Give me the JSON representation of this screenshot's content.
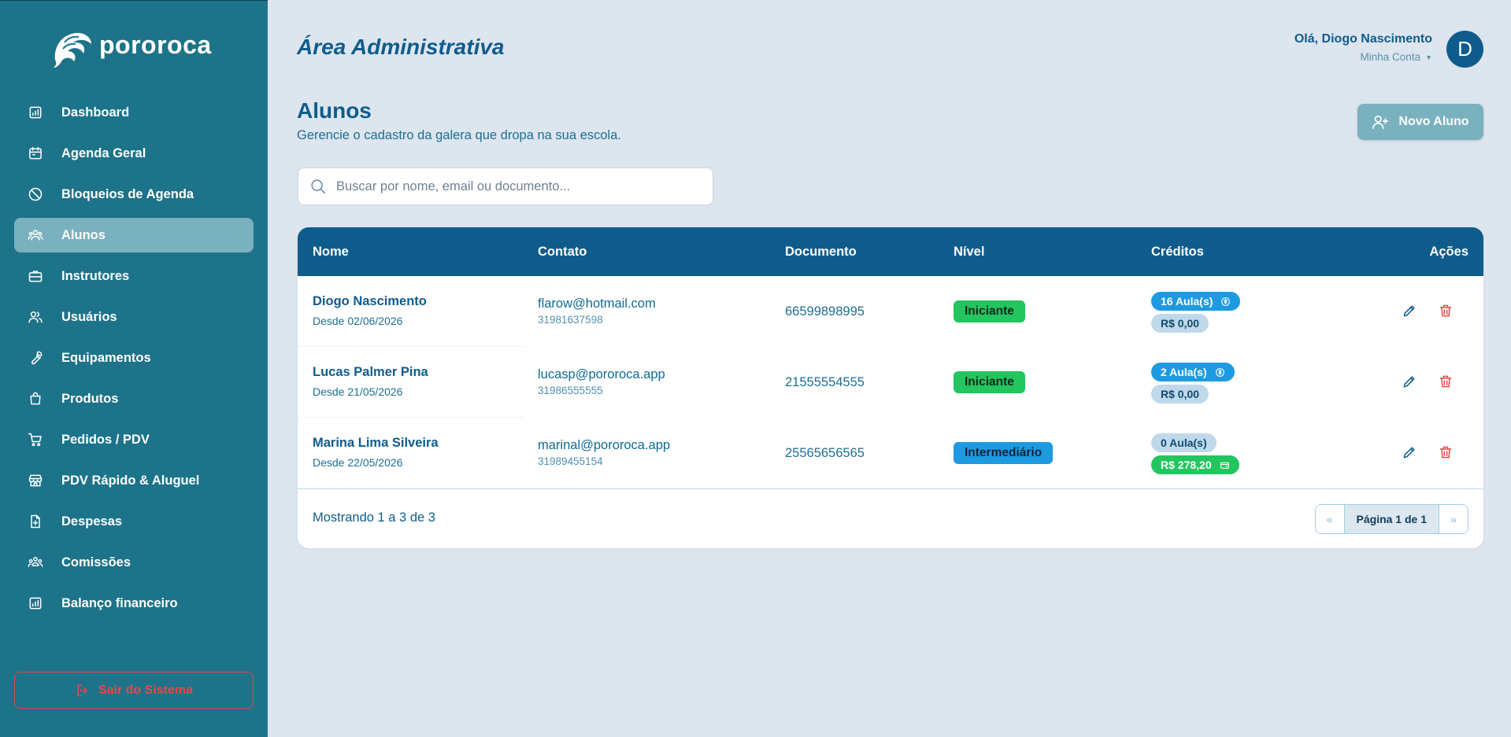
{
  "brand": {
    "name": "pororoca"
  },
  "header": {
    "title": "Área Administrativa",
    "greeting": "Olá, Diogo Nascimento",
    "account_label": "Minha Conta",
    "avatar_initial": "D"
  },
  "sidebar": {
    "items": [
      {
        "label": "Dashboard",
        "icon": "bar-chart-icon",
        "active": false
      },
      {
        "label": "Agenda Geral",
        "icon": "calendar-icon",
        "active": false
      },
      {
        "label": "Bloqueios de Agenda",
        "icon": "ban-icon",
        "active": false
      },
      {
        "label": "Alunos",
        "icon": "users-icon",
        "active": true
      },
      {
        "label": "Instrutores",
        "icon": "briefcase-icon",
        "active": false
      },
      {
        "label": "Usuários",
        "icon": "user-group-icon",
        "active": false
      },
      {
        "label": "Equipamentos",
        "icon": "wrench-icon",
        "active": false
      },
      {
        "label": "Produtos",
        "icon": "shopping-bag-icon",
        "active": false
      },
      {
        "label": "Pedidos / PDV",
        "icon": "cart-icon",
        "active": false
      },
      {
        "label": "PDV Rápido & Aluguel",
        "icon": "store-icon",
        "active": false
      },
      {
        "label": "Despesas",
        "icon": "file-plus-icon",
        "active": false
      },
      {
        "label": "Comissões",
        "icon": "team-icon",
        "active": false
      },
      {
        "label": "Balanço financeiro",
        "icon": "bar-chart-icon",
        "active": false
      }
    ],
    "logout_label": "Sair do Sistema"
  },
  "page": {
    "title": "Alunos",
    "subtitle": "Gerencie o cadastro da galera que dropa na sua escola.",
    "new_button": "Novo Aluno"
  },
  "search": {
    "placeholder": "Buscar por nome, email ou documento...",
    "value": ""
  },
  "table": {
    "headers": {
      "name": "Nome",
      "contact": "Contato",
      "document": "Documento",
      "level": "Nível",
      "credits": "Créditos",
      "actions": "Ações"
    },
    "rows": [
      {
        "name": "Diogo Nascimento",
        "since": "Desde 02/06/2026",
        "email": "flarow@hotmail.com",
        "phone": "31981637598",
        "document": "66599898995",
        "level": "Iniciante",
        "lessons": "16 Aula(s)",
        "balance": "R$ 0,00"
      },
      {
        "name": "Lucas Palmer Pina",
        "since": "Desde 21/05/2026",
        "email": "lucasp@pororoca.app",
        "phone": "31986555555",
        "document": "21555554555",
        "level": "Iniciante",
        "lessons": "2 Aula(s)",
        "balance": "R$ 0,00"
      },
      {
        "name": "Marina Lima Silveira",
        "since": "Desde 22/05/2026",
        "email": "marinal@pororoca.app",
        "phone": "31989455154",
        "document": "25565656565",
        "level": "Intermediário",
        "lessons": "0 Aula(s)",
        "balance": "R$ 278,20"
      }
    ],
    "footer": {
      "showing": "Mostrando 1 a 3 de 3",
      "page": "Página 1 de 1",
      "prev": "«",
      "next": "»"
    }
  },
  "colors": {
    "sidebar": "#1d7389",
    "primary": "#0f5c8c",
    "active_item": "#7ab1bf",
    "success": "#22c55e",
    "info": "#1e9be0",
    "danger": "#e84848",
    "background": "#dde5ef"
  }
}
